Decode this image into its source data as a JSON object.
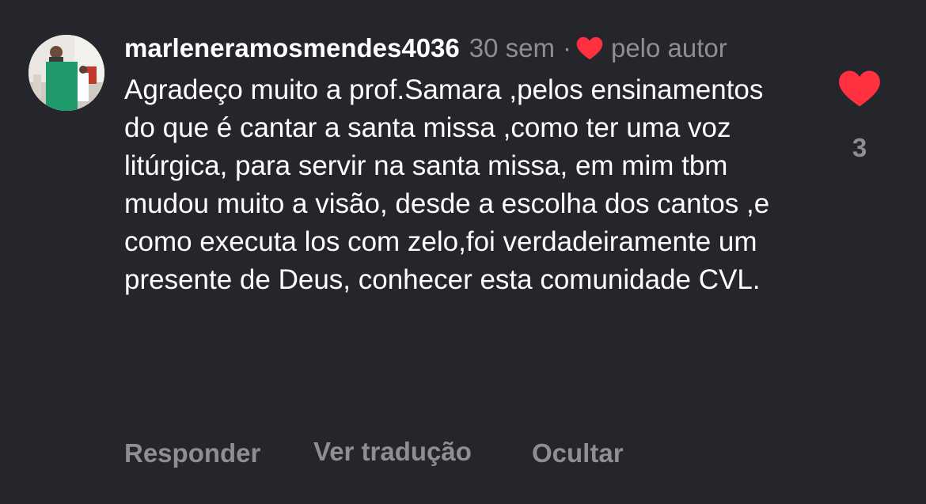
{
  "comment": {
    "username": "marleneramosmendes4036",
    "time": "30 sem",
    "separator": "·",
    "liked_by_author_label": "pelo autor",
    "text": "Agradeço muito a prof.Samara ,pelos ensinamentos do que é cantar a santa missa ,como ter uma voz litúrgica, para servir na santa missa, em mim tbm mudou muito a visão, desde a escolha dos cantos ,e como executa los com zelo,foi verdadeiramente um presente de Deus, conhecer esta comunidade CVL.",
    "like_count": "3"
  },
  "actions": {
    "reply": "Responder",
    "translate": "Ver tradução",
    "hide": "Ocultar"
  },
  "icons": {
    "avatar": "user-photo-avatar",
    "author_heart": "heart-icon",
    "like": "heart-filled-icon"
  },
  "colors": {
    "background": "#25262b",
    "heart": "#ff3040",
    "secondary_text": "#8e8e93",
    "primary_text": "#ffffff"
  }
}
